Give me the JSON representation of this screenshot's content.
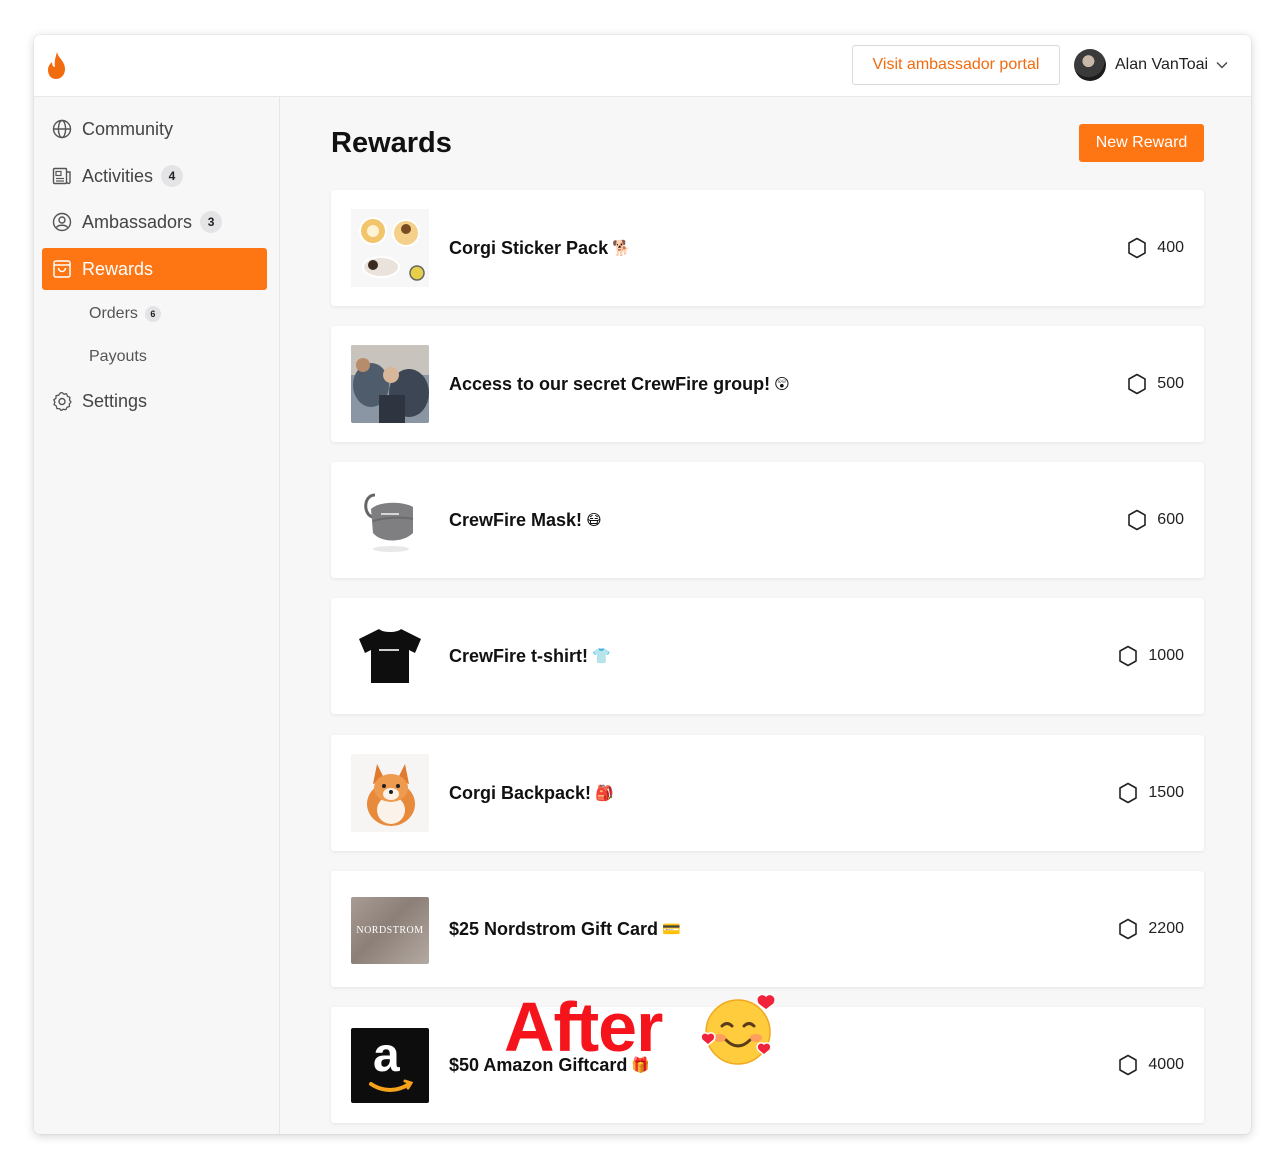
{
  "app": {
    "logo_icon": "flame-icon",
    "brand_color": "#fd7613",
    "portal_button": "Visit ambassador portal",
    "user": {
      "name": "Alan VanToai",
      "menu_icon": "chevron-down-icon"
    }
  },
  "sidebar": {
    "items": [
      {
        "label": "Community",
        "icon": "globe-icon",
        "badge": ""
      },
      {
        "label": "Activities",
        "icon": "newspaper-icon",
        "badge": "4"
      },
      {
        "label": "Ambassadors",
        "icon": "user-circle-icon",
        "badge": "3"
      },
      {
        "label": "Rewards",
        "icon": "shopping-bag-icon",
        "badge": "",
        "active": true
      },
      {
        "label": "Settings",
        "icon": "gear-icon",
        "badge": ""
      }
    ],
    "sub_items": [
      {
        "label": "Orders",
        "badge": "6"
      },
      {
        "label": "Payouts",
        "badge": ""
      }
    ]
  },
  "main": {
    "title": "Rewards",
    "new_button": "New Reward",
    "points_icon": "hexagon-icon",
    "rewards": [
      {
        "title": "Corgi Sticker Pack",
        "emoji": "🐕",
        "points": "400",
        "image": "corgi-stickers"
      },
      {
        "title": "Access to our secret CrewFire group!",
        "emoji": "😲",
        "points": "500",
        "image": "group-photo"
      },
      {
        "title": "CrewFire Mask!",
        "emoji": "😷",
        "points": "600",
        "image": "mask"
      },
      {
        "title": "CrewFire t-shirt!",
        "emoji": "👕",
        "points": "1000",
        "image": "tshirt"
      },
      {
        "title": "Corgi Backpack!",
        "emoji": "🎒",
        "points": "1500",
        "image": "corgi-backpack"
      },
      {
        "title": "$25 Nordstrom Gift Card",
        "emoji": "💳",
        "points": "2200",
        "image": "nordstrom-card"
      },
      {
        "title": "$50 Amazon Giftcard",
        "emoji": "🎁",
        "points": "4000",
        "image": "amazon-card"
      }
    ]
  },
  "overlay": {
    "text": "After",
    "emoji": "smiling-face-with-hearts",
    "color": "#f5141c"
  },
  "thumb_text": {
    "nordstrom": "NORDSTROM",
    "amazon": "a"
  }
}
